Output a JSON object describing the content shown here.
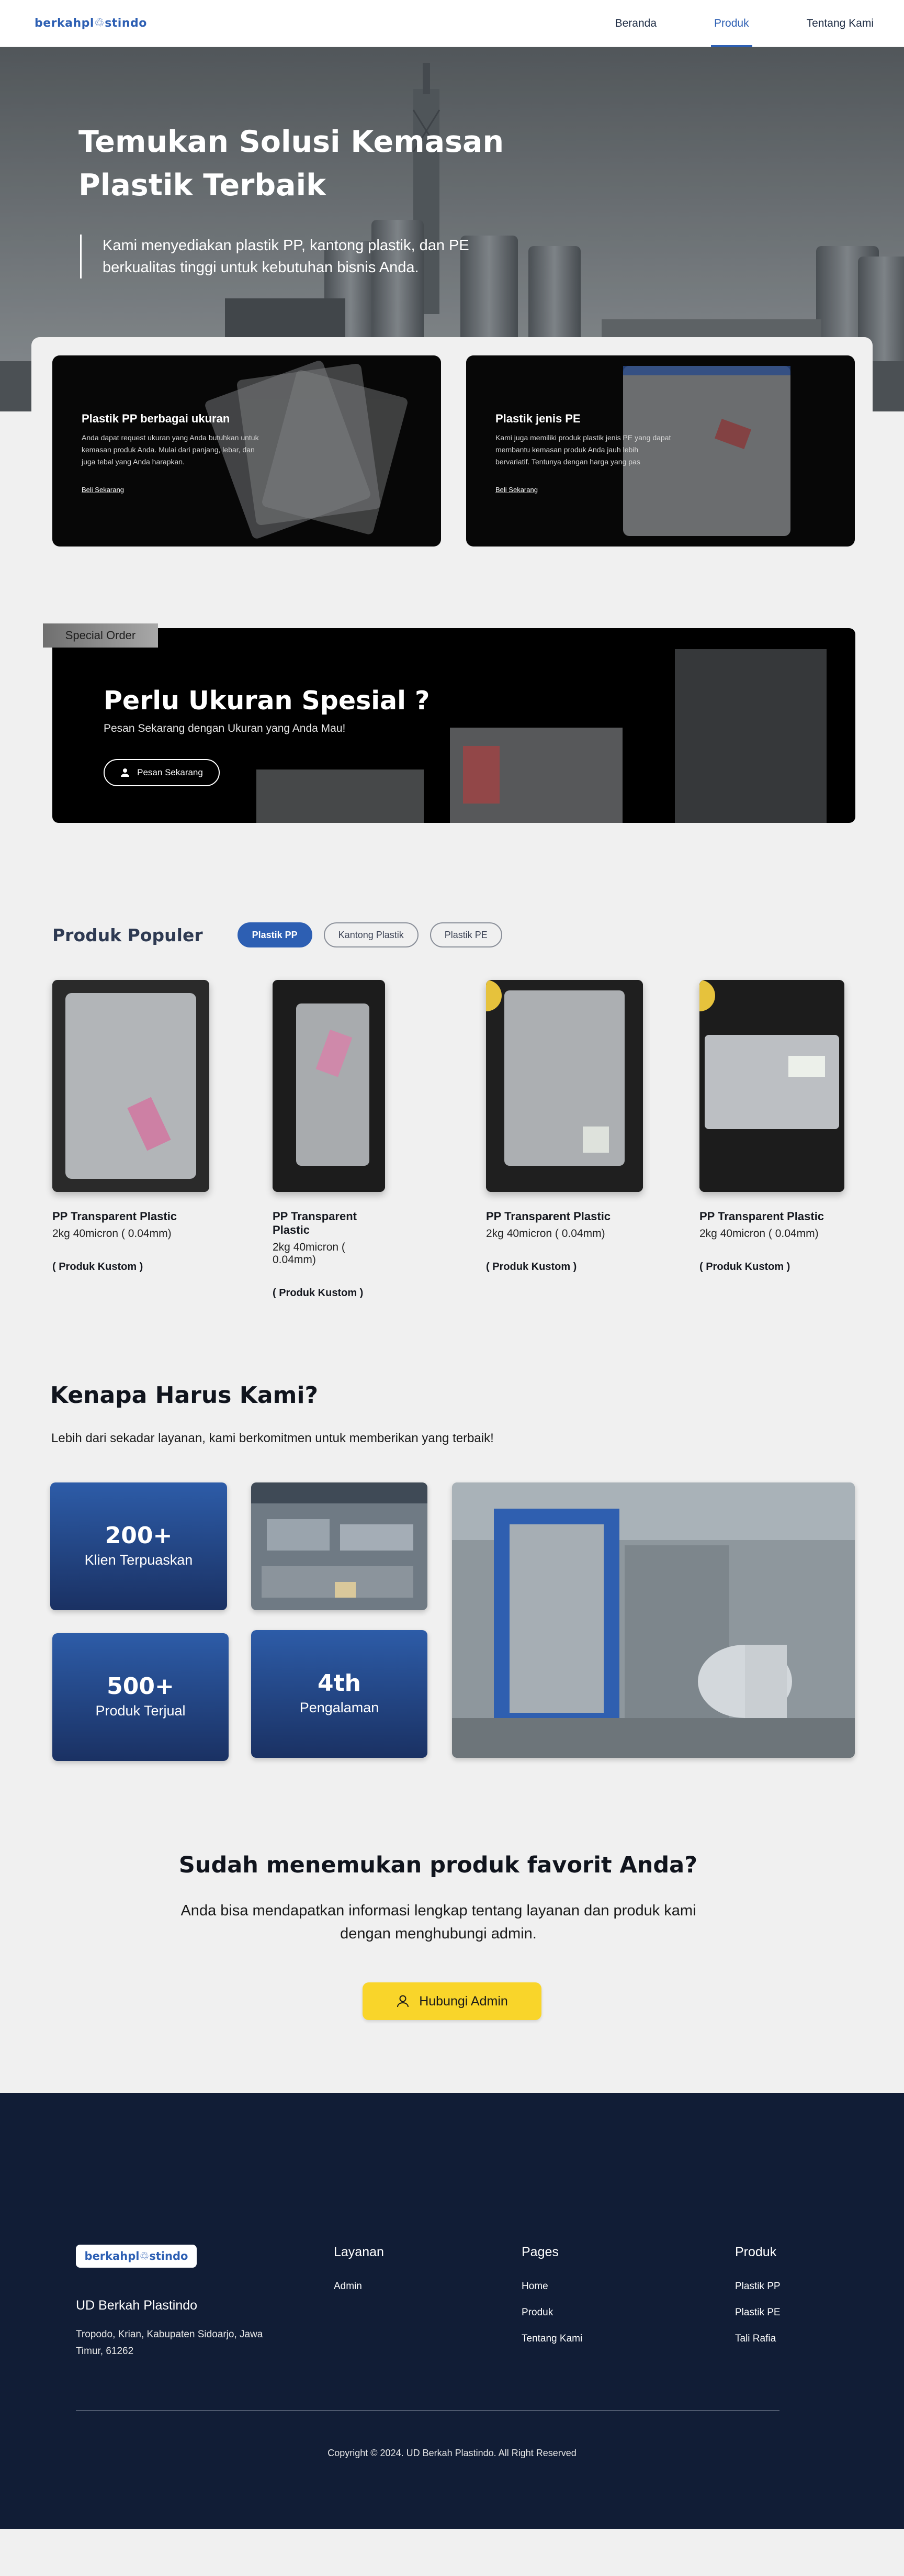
{
  "nav": {
    "logo": "berkahpl",
    "logo_tail": "stindo",
    "links": [
      {
        "label": "Beranda",
        "active": false
      },
      {
        "label": "Produk",
        "active": true
      },
      {
        "label": "Tentang Kami",
        "active": false
      }
    ]
  },
  "hero": {
    "title": "Temukan Solusi Kemasan Plastik Terbaik",
    "description": "Kami menyediakan plastik PP, kantong plastik, dan PE berkualitas tinggi untuk kebutuhan bisnis Anda."
  },
  "categories": [
    {
      "title": "Plastik PP berbagai ukuran",
      "description": "Anda dapat request ukuran yang Anda butuhkan untuk kemasan produk Anda. Mulai dari panjang, lebar, dan juga tebal yang Anda harapkan.",
      "link": "Beli Sekarang"
    },
    {
      "title": "Plastik jenis PE",
      "description": "Kami juga memiliki produk plastik jenis PE yang dapat membantu kemasan produk Anda jauh lebih bervariatif. Tentunya dengan harga yang pas",
      "link": "Beli Sekarang"
    }
  ],
  "special": {
    "tag": "Special Order",
    "title": "Perlu Ukuran Spesial ?",
    "subtitle": "Pesan Sekarang dengan Ukuran yang Anda Mau!",
    "button": "Pesan Sekarang"
  },
  "populer": {
    "title": "Produk Populer",
    "filters": [
      {
        "label": "Plastik PP",
        "active": true
      },
      {
        "label": "Kantong Plastik",
        "active": false
      },
      {
        "label": "Plastik PE",
        "active": false
      }
    ],
    "products": [
      {
        "name": "PP Transparent Plastic",
        "spec": "2kg 40micron ( 0.04mm)",
        "tag": "( Produk Kustom )"
      },
      {
        "name": "PP Transparent Plastic",
        "spec": "2kg 40micron ( 0.04mm)",
        "tag": "( Produk Kustom )"
      },
      {
        "name": "PP Transparent Plastic",
        "spec": "2kg 40micron ( 0.04mm)",
        "tag": "( Produk Kustom )"
      },
      {
        "name": "PP Transparent Plastic",
        "spec": "2kg 40micron ( 0.04mm)",
        "tag": "( Produk Kustom )"
      }
    ]
  },
  "why": {
    "title": "Kenapa Harus Kami?",
    "subtitle": "Lebih dari sekadar layanan, kami berkomitmen untuk memberikan yang terbaik!",
    "stats": [
      {
        "value": "200+",
        "label": "Klien Terpuaskan"
      },
      {
        "value": "500+",
        "label": "Produk Terjual"
      },
      {
        "value": "4th",
        "label": "Pengalaman"
      }
    ]
  },
  "cta": {
    "title": "Sudah menemukan produk favorit Anda?",
    "description": "Anda bisa mendapatkan informasi lengkap tentang layanan dan produk kami dengan menghubungi admin.",
    "button": "Hubungi Admin"
  },
  "footer": {
    "logo": "berkahpl",
    "logo_tail": "stindo",
    "company": "UD Berkah Plastindo",
    "address": "Tropodo, Krian, Kabupaten Sidoarjo, Jawa Timur, 61262",
    "columns": [
      {
        "title": "Layanan",
        "links": [
          "Admin"
        ]
      },
      {
        "title": "Pages",
        "links": [
          "Home",
          "Produk",
          "Tentang Kami"
        ]
      },
      {
        "title": "Produk",
        "links": [
          "Plastik PP",
          "Plastik PE",
          "Tali Rafia"
        ]
      }
    ],
    "copyright": "Copyright © 2024. UD Berkah Plastindo. All Right Reserved"
  },
  "colors": {
    "primary": "#2d5fb3",
    "footer_bg": "#111d36",
    "cta_yellow": "#f9d52a",
    "stat_gradient_top": "#2d5ca8",
    "stat_gradient_bottom": "#1a3163"
  }
}
